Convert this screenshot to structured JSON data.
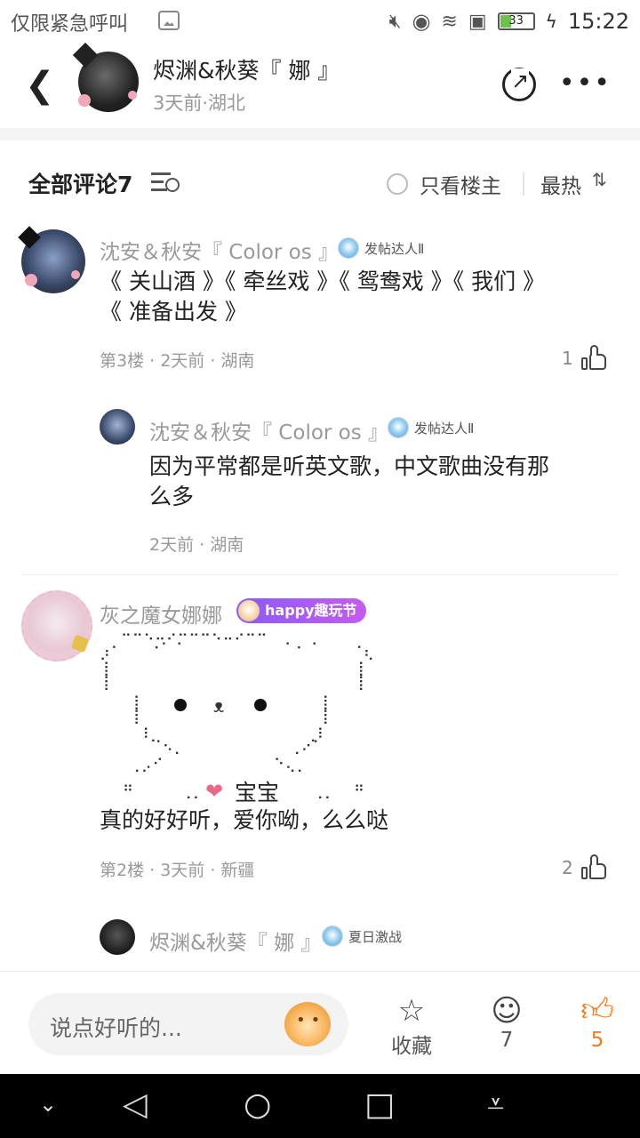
{
  "status_bar": {
    "left_text": "仅限紧急呼叫",
    "battery": "33",
    "time": "15:22"
  },
  "header": {
    "author_name": "烬渊&秋葵『 娜 』",
    "author_meta": "3天前·湖北"
  },
  "comments_header": {
    "title": "全部评论",
    "count": "7",
    "only_host": "只看楼主",
    "sort": "最热",
    "sort_icon": "⇅"
  },
  "comments": [
    {
      "user": "沈安＆秋安『 Color os 』",
      "badge": "发帖达人Ⅱ",
      "text_line1": "《 关山酒 》《 牵丝戏 》《 鸳鸯戏 》《 我们 》",
      "text_line2": "《 准备出发 》",
      "meta": "第3楼 · 2天前 · 湖南",
      "likes": "1"
    },
    {
      "user": "沈安＆秋安『 Color os 』",
      "badge": "发帖达人Ⅱ",
      "text_line1": "因为平常都是听英文歌，中文歌曲没有那",
      "text_line2": "么多",
      "meta": "2天前 · 湖南"
    },
    {
      "user": "灰之魔女娜娜",
      "badge": "happy趣玩节",
      "heart_text": "宝宝",
      "text": "真的好好听，爱你呦，么么哒",
      "meta": "第2楼 · 3天前 · 新疆",
      "likes": "2"
    },
    {
      "user": "烬渊&秋葵『 娜 』",
      "badge": "夏日激战"
    }
  ],
  "bottom_bar": {
    "input_placeholder": "说点好听的...",
    "favorite_label": "收藏",
    "comment_count": "7",
    "like_count": "5"
  }
}
